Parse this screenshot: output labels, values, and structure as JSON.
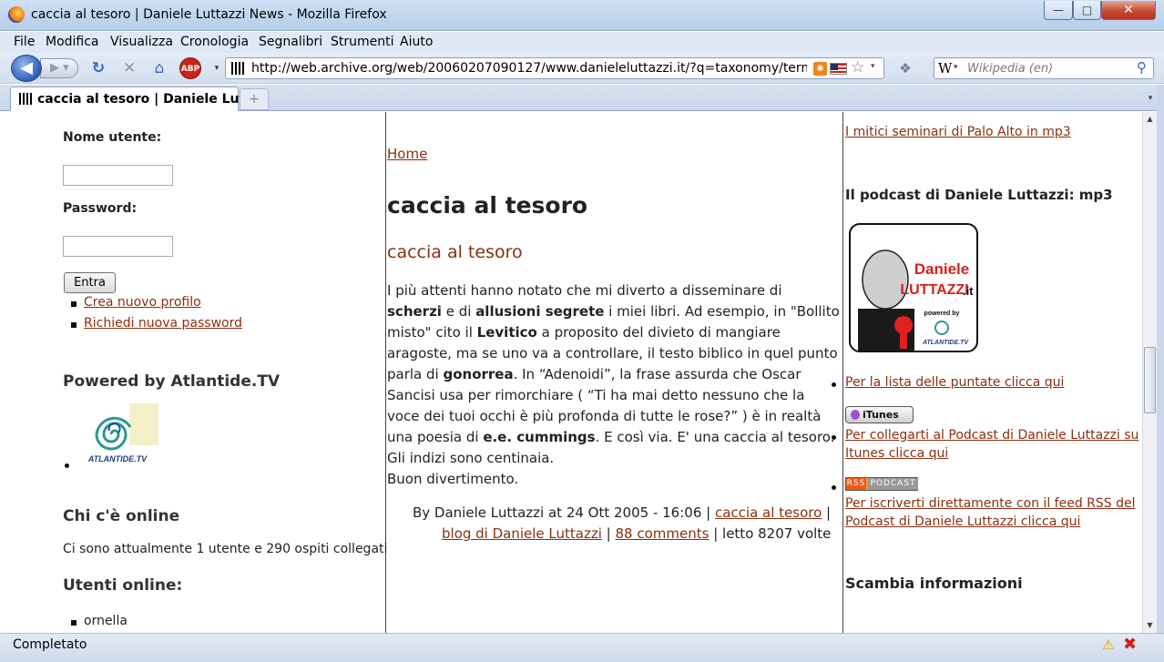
{
  "window": {
    "title": "caccia al tesoro | Daniele Luttazzi News - Mozilla Firefox",
    "minimize_glyph": "—",
    "maximize_glyph": "□",
    "close_glyph": "✕"
  },
  "menu": [
    "File",
    "Modifica",
    "Visualizza",
    "Cronologia",
    "Segnalibri",
    "Strumenti",
    "Aiuto"
  ],
  "toolbar": {
    "url": "http://web.archive.org/web/20060207090127/www.danieleluttazzi.it/?q=taxonomy/term/41",
    "abp_label": "ABP",
    "search_placeholder": "Wikipedia (en)",
    "search_engine_glyph": "W"
  },
  "tabs": {
    "active_label": "caccia al tesoro | Daniele Lutt...",
    "new_tab_glyph": "+"
  },
  "left": {
    "username_label": "Nome utente:",
    "password_label": "Password:",
    "login_button": "Entra",
    "links": [
      "Crea nuovo profilo",
      "Richiedi nuova password"
    ],
    "powered_title": "Powered by Atlantide.TV",
    "atlantide_logo_text": "ATLANTIDE.TV",
    "online_title": "Chi c'è online",
    "online_text": "Ci sono attualmente 1 utente e 290 ospiti collegati",
    "users_title": "Utenti online:",
    "users": [
      "ornella"
    ]
  },
  "center": {
    "breadcrumb": "Home",
    "page_title": "caccia al tesoro",
    "node_title": "caccia al tesoro",
    "body": {
      "p1": "I più attenti hanno notato che mi diverto a disseminare di ",
      "b1": "scherzi",
      "p2": " e di ",
      "b2": "allusioni segrete",
      "p3": " i miei libri. Ad esempio, in \"Bollito misto\" cito il ",
      "b3": "Levitico",
      "p4": " a proposito del divieto di mangiare aragoste, ma se uno va a controllare, il testo biblico in quel punto parla di ",
      "b4": "gonorrea",
      "p5": ". In “Adenoidi”, la frase assurda che Oscar Sancisi usa per rimorchiare ( “Ti ha mai detto nessuno che la voce dei tuoi occhi è più profonda di tutte le rose?” ) è in realtà una poesia di ",
      "b5": "e.e. cummings",
      "p6": ". E così via. E' una caccia al tesoro. Gli indizi sono centinaia.",
      "p7": "Buon divertimento."
    },
    "meta": {
      "byline": "By Daniele Luttazzi at 24 Ott 2005 - 16:06",
      "sep": " | ",
      "tag1": "caccia al tesoro",
      "tag2": "blog di Daniele Luttazzi",
      "comments": "88 comments",
      "reads": "letto 8207 volte"
    }
  },
  "right": {
    "seminari_link": "I mitici seminari di Palo Alto in mp3",
    "podcast_title": "Il podcast di Daniele Luttazzi: mp3",
    "logo_line1": "Daniele",
    "logo_line2": "LUTTAZZI",
    "logo_tld": ".it",
    "logo_powered": "powered by",
    "logo_atlantide": "ATLANTIDE.TV",
    "lista_link": "Per la lista delle puntate clicca qui",
    "itunes_badge": "iTunes",
    "itunes_link_1": "Per collegarti al Podcast di Daniele Luttazzi su",
    "itunes_link_2": "Itunes clicca qui",
    "rss_badge_left": "RSS",
    "rss_badge_right": "PODCAST",
    "rss_link_1": "Per iscriverti direttamente con il feed RSS del",
    "rss_link_2": "Podcast di Daniele Luttazzi clicca qui",
    "scambia_title": "Scambia informazioni"
  },
  "status": {
    "text": "Completato"
  },
  "colors": {
    "link": "#8b2f0f",
    "chrome": "#dfe8f5"
  }
}
